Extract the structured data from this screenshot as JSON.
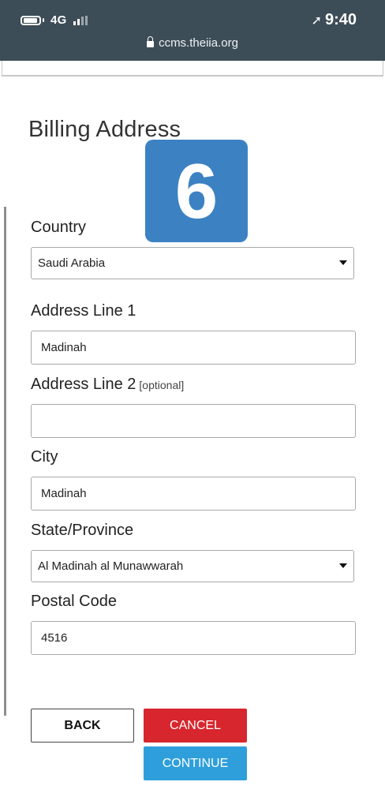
{
  "status_bar": {
    "network": "4G",
    "time": "9:40",
    "icons": [
      "battery-icon",
      "signal-icon",
      "location-arrow-icon",
      "lock-icon"
    ]
  },
  "browser": {
    "url": "ccms.theiia.org"
  },
  "page": {
    "heading": "Billing Address",
    "step_badge": "6"
  },
  "form": {
    "country": {
      "label": "Country",
      "value": "Saudi Arabia"
    },
    "address1": {
      "label": "Address Line 1",
      "value": "Madinah"
    },
    "address2": {
      "label": "Address Line 2",
      "optional": "[optional]",
      "value": ""
    },
    "city": {
      "label": "City",
      "value": "Madinah"
    },
    "state": {
      "label": "State/Province",
      "value": "Al Madinah al Munawwarah"
    },
    "postal": {
      "label": "Postal Code",
      "value": "4516"
    }
  },
  "buttons": {
    "back": "BACK",
    "cancel": "CANCEL",
    "continue": "CONTINUE"
  },
  "colors": {
    "status_bar_bg": "#3d4d57",
    "badge": "#3c82c3",
    "cancel": "#d7262d",
    "continue": "#2e9fdb"
  }
}
